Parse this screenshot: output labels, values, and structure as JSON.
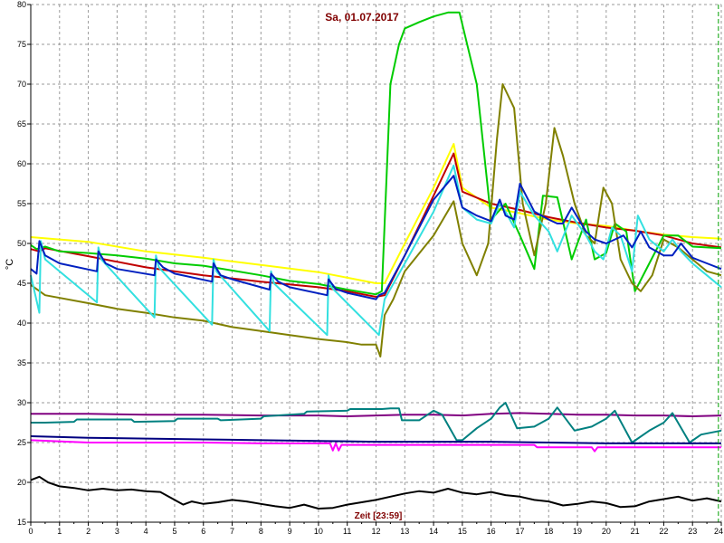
{
  "chart_data": {
    "type": "line",
    "title": "Sa, 01.07.2017",
    "xlabel": "Zeit [23:59]",
    "ylabel": "°C",
    "xlim": [
      0,
      24
    ],
    "ylim": [
      15,
      80
    ],
    "xticks": [
      0,
      1,
      2,
      3,
      4,
      5,
      6,
      7,
      8,
      9,
      10,
      11,
      12,
      13,
      14,
      15,
      16,
      17,
      18,
      19,
      20,
      21,
      22,
      23,
      24
    ],
    "yticks": [
      15,
      20,
      25,
      30,
      35,
      40,
      45,
      50,
      55,
      60,
      65,
      70,
      75,
      80
    ],
    "grid": true,
    "marker_x": 23.9,
    "series": [
      {
        "color": "#ffff00",
        "x": [
          0,
          2,
          4,
          6,
          8,
          10,
          12,
          12.3,
          13,
          14,
          14.7,
          15,
          16,
          17,
          18,
          19,
          20,
          21,
          22,
          23,
          24
        ],
        "y": [
          50.8,
          50.2,
          49.0,
          48.2,
          47.3,
          46.4,
          45.0,
          45.0,
          50.0,
          57.0,
          62.5,
          57.0,
          54.5,
          53.8,
          53.0,
          52.5,
          52.2,
          51.6,
          51.1,
          50.8,
          50.6
        ]
      },
      {
        "color": "#c00000",
        "x": [
          0,
          0.3,
          0.5,
          2,
          4,
          6,
          8,
          10,
          11,
          12,
          12.3,
          13,
          14,
          14.7,
          15,
          16,
          17,
          18,
          19,
          20,
          21,
          22,
          23,
          24
        ],
        "y": [
          49.3,
          49.0,
          49.4,
          48.4,
          47.0,
          46.0,
          45.2,
          44.5,
          44.0,
          43.3,
          43.5,
          48.5,
          56.0,
          61.3,
          56.5,
          55.0,
          54.2,
          53.3,
          52.6,
          52.0,
          51.6,
          51.0,
          50.0,
          49.5
        ]
      },
      {
        "color": "#00cc00",
        "x": [
          0,
          0.2,
          0.5,
          1,
          2,
          3,
          4,
          5,
          6,
          7,
          8,
          9,
          10,
          11,
          12,
          12.2,
          12.5,
          12.8,
          13,
          13.5,
          14,
          14.5,
          14.9,
          15.5,
          16.0,
          16.5,
          17.0,
          17.5,
          17.8,
          18.3,
          18.8,
          19.3,
          19.6,
          20.0,
          20.3,
          20.7,
          21.0,
          21.5,
          22.0,
          22.5,
          23.0,
          23.5,
          24.0
        ],
        "y": [
          49.8,
          49.3,
          49.6,
          49.0,
          48.8,
          48.5,
          48.1,
          47.5,
          47.2,
          46.6,
          46.0,
          45.3,
          44.9,
          44.2,
          43.6,
          44.0,
          70.0,
          75.0,
          77.0,
          77.8,
          78.5,
          79.0,
          79.0,
          70.0,
          53.0,
          55.0,
          51.0,
          46.8,
          56.0,
          55.8,
          48.0,
          53.0,
          48.0,
          48.8,
          52.5,
          51.5,
          44.0,
          47.5,
          51.0,
          51.0,
          49.6,
          49.5,
          49.4
        ]
      },
      {
        "color": "#808000",
        "x": [
          0,
          0.5,
          2,
          3,
          4,
          5,
          6,
          7,
          8,
          9,
          10,
          11,
          11.5,
          12,
          12.15,
          12.3,
          12.6,
          13,
          14,
          14.7,
          15,
          15.5,
          15.9,
          16.2,
          16.4,
          16.8,
          17.1,
          17.5,
          17.9,
          18.2,
          18.5,
          18.9,
          19.3,
          19.6,
          19.9,
          20.2,
          20.5,
          20.9,
          21.2,
          21.6,
          22.0,
          22.5,
          23.0,
          23.5,
          24.0
        ],
        "y": [
          44.8,
          43.5,
          42.5,
          41.8,
          41.3,
          40.7,
          40.3,
          39.5,
          39.0,
          38.5,
          38.0,
          37.6,
          37.3,
          37.3,
          35.8,
          41.0,
          43.0,
          46.5,
          51.0,
          55.3,
          50.0,
          46.0,
          50.0,
          63.0,
          70.0,
          67.0,
          55.0,
          48.5,
          55.0,
          64.5,
          61.0,
          55.0,
          51.0,
          50.0,
          57.0,
          55.0,
          48.0,
          45.0,
          44.0,
          46.0,
          50.5,
          49.5,
          48.0,
          46.5,
          46.0
        ]
      },
      {
        "color": "#33e0e0",
        "x": [
          0,
          0.3,
          0.35,
          0.5,
          2.3,
          2.35,
          2.45,
          4.3,
          4.35,
          4.45,
          6.3,
          6.35,
          6.45,
          8.3,
          8.35,
          8.45,
          10.3,
          10.35,
          10.45,
          12.1,
          12.3,
          13,
          14,
          14.7,
          15,
          15.5,
          16.0,
          16.3,
          16.5,
          16.8,
          17.0,
          17.5,
          18.0,
          18.3,
          18.8,
          19.3,
          19.6,
          19.9,
          20.2,
          20.5,
          20.9,
          21.1,
          21.5,
          22.0,
          22.3,
          22.6,
          23.0,
          23.5,
          24.0
        ],
        "y": [
          46.0,
          41.3,
          50.3,
          48.0,
          42.6,
          49.5,
          48.0,
          40.7,
          48.5,
          47.0,
          39.8,
          48.0,
          46.5,
          39.0,
          46.5,
          45.0,
          38.5,
          46.0,
          44.5,
          38.5,
          43.0,
          47.5,
          54.0,
          59.8,
          54.5,
          53.0,
          52.5,
          55.0,
          54.0,
          52.0,
          56.5,
          53.5,
          51.5,
          49.0,
          53.5,
          51.0,
          49.0,
          48.0,
          52.0,
          51.0,
          46.5,
          53.5,
          50.5,
          49.0,
          50.5,
          49.0,
          47.5,
          46.0,
          44.5
        ]
      },
      {
        "color": "#0020c0",
        "x": [
          0,
          0.2,
          0.3,
          0.5,
          1,
          2.3,
          2.35,
          2.6,
          3,
          4.3,
          4.35,
          4.6,
          5,
          6.3,
          6.35,
          6.6,
          7,
          8.3,
          8.35,
          8.6,
          9,
          10.3,
          10.35,
          10.6,
          11,
          12,
          12.1,
          12.3,
          13,
          14,
          14.7,
          15,
          15.5,
          16.0,
          16.3,
          16.5,
          16.8,
          17.0,
          17.5,
          18.0,
          18.3,
          18.5,
          18.8,
          19.3,
          19.6,
          20.0,
          20.3,
          20.6,
          20.9,
          21.2,
          21.5,
          22.0,
          22.3,
          22.6,
          23.0,
          23.5,
          24.0
        ],
        "y": [
          46.8,
          46.2,
          50.3,
          48.5,
          47.5,
          46.5,
          49.0,
          47.5,
          46.8,
          46.0,
          48.0,
          47.0,
          46.2,
          45.2,
          47.5,
          46.0,
          45.5,
          44.2,
          46.2,
          45.2,
          44.5,
          43.5,
          45.5,
          44.3,
          43.8,
          43.0,
          43.5,
          43.8,
          48.5,
          55.5,
          58.5,
          54.5,
          53.5,
          52.8,
          55.5,
          53.5,
          53.0,
          57.5,
          54.0,
          53.0,
          52.5,
          52.5,
          54.5,
          51.5,
          50.5,
          50.0,
          50.5,
          51.0,
          49.5,
          51.5,
          49.5,
          48.5,
          48.5,
          50.0,
          48.2,
          47.5,
          46.8
        ]
      },
      {
        "color": "#800080",
        "x": [
          0,
          2,
          4,
          6,
          8,
          9,
          10,
          11,
          12,
          13,
          14,
          15,
          16,
          17,
          18,
          19,
          20,
          21,
          22,
          23,
          24
        ],
        "y": [
          28.6,
          28.6,
          28.5,
          28.5,
          28.4,
          28.4,
          28.4,
          28.3,
          28.4,
          28.5,
          28.5,
          28.4,
          28.6,
          28.7,
          28.6,
          28.5,
          28.5,
          28.4,
          28.4,
          28.3,
          28.4
        ]
      },
      {
        "color": "#008080",
        "x": [
          0,
          0.5,
          1.5,
          1.6,
          3.5,
          3.6,
          5.0,
          5.1,
          6.5,
          6.6,
          8.0,
          8.1,
          9.5,
          9.6,
          11.0,
          11.1,
          12.2,
          12.5,
          12.8,
          12.9,
          13.5,
          14.0,
          14.3,
          14.8,
          15.0,
          15.5,
          16.0,
          16.3,
          16.5,
          16.9,
          17.5,
          18.0,
          18.3,
          18.9,
          19.5,
          20.0,
          20.3,
          20.9,
          21.5,
          22.0,
          22.3,
          22.9,
          23.3,
          24.0
        ],
        "y": [
          27.5,
          27.5,
          27.6,
          27.9,
          27.9,
          27.6,
          27.7,
          28.0,
          28.0,
          27.8,
          28.0,
          28.3,
          28.6,
          28.9,
          29.0,
          29.2,
          29.2,
          29.3,
          29.3,
          27.8,
          27.8,
          29.0,
          28.5,
          25.3,
          25.3,
          26.8,
          28.0,
          29.4,
          30.0,
          26.8,
          27.0,
          28.0,
          29.4,
          26.5,
          27.0,
          28.0,
          29.0,
          25.0,
          26.5,
          27.5,
          28.7,
          25.0,
          26.0,
          26.5
        ]
      },
      {
        "color": "#ff00ff",
        "x": [
          0,
          2,
          4,
          6,
          8,
          10,
          10.4,
          10.5,
          10.6,
          10.7,
          10.8,
          12,
          14,
          16,
          17.5,
          17.6,
          19.5,
          19.6,
          19.7,
          20,
          22,
          24
        ],
        "y": [
          25.3,
          25.0,
          25.0,
          25.0,
          24.9,
          24.9,
          24.9,
          24.0,
          24.9,
          24.0,
          24.7,
          24.7,
          24.7,
          24.7,
          24.7,
          24.4,
          24.4,
          23.9,
          24.4,
          24.4,
          24.4,
          24.4
        ]
      },
      {
        "color": "#000080",
        "x": [
          0,
          2,
          4,
          6,
          8,
          10,
          12,
          14,
          16,
          18,
          20,
          22,
          24
        ],
        "y": [
          25.8,
          25.6,
          25.5,
          25.4,
          25.3,
          25.2,
          25.1,
          25.1,
          25.1,
          25.0,
          24.9,
          24.9,
          24.9
        ]
      },
      {
        "color": "#000000",
        "x": [
          0,
          0.3,
          0.6,
          1,
          1.5,
          2,
          2.5,
          3,
          3.5,
          4,
          4.5,
          5,
          5.3,
          5.6,
          6,
          6.5,
          7,
          7.5,
          8,
          8.5,
          9,
          9.5,
          10,
          10.5,
          11,
          11.5,
          12,
          12.5,
          13,
          13.5,
          14,
          14.5,
          15,
          15.5,
          16,
          16.5,
          17,
          17.5,
          18,
          18.5,
          19,
          19.5,
          20,
          20.5,
          21,
          21.5,
          22,
          22.5,
          23,
          23.5,
          24
        ],
        "y": [
          20.3,
          20.7,
          20.0,
          19.5,
          19.3,
          19.0,
          19.2,
          19.0,
          19.1,
          18.9,
          18.8,
          17.8,
          17.2,
          17.6,
          17.3,
          17.5,
          17.8,
          17.6,
          17.3,
          17.0,
          16.8,
          17.2,
          16.7,
          16.8,
          17.2,
          17.5,
          17.8,
          18.2,
          18.6,
          18.9,
          18.7,
          19.2,
          18.7,
          18.5,
          18.8,
          18.4,
          18.2,
          17.8,
          17.6,
          17.1,
          17.3,
          17.6,
          17.4,
          16.9,
          17.0,
          17.6,
          17.9,
          18.2,
          17.7,
          18.0,
          17.6
        ]
      }
    ]
  }
}
